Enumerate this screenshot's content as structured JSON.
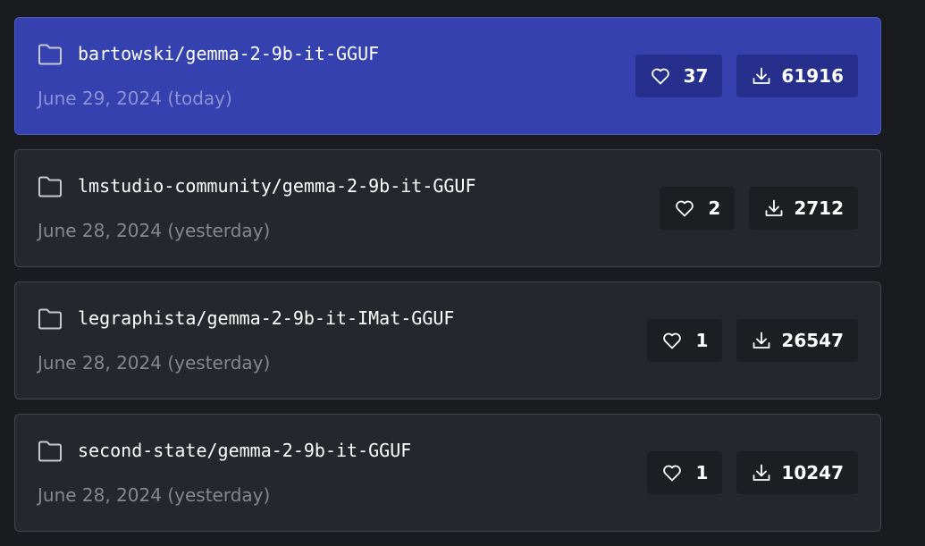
{
  "models": [
    {
      "name": "bartowski/gemma-2-9b-it-GGUF",
      "date": "June 29, 2024 (today)",
      "likes": "37",
      "downloads": "61916",
      "selected": true
    },
    {
      "name": "lmstudio-community/gemma-2-9b-it-GGUF",
      "date": "June 28, 2024 (yesterday)",
      "likes": "2",
      "downloads": "2712",
      "selected": false
    },
    {
      "name": "legraphista/gemma-2-9b-it-IMat-GGUF",
      "date": "June 28, 2024 (yesterday)",
      "likes": "1",
      "downloads": "26547",
      "selected": false
    },
    {
      "name": "second-state/gemma-2-9b-it-GGUF",
      "date": "June 28, 2024 (yesterday)",
      "likes": "1",
      "downloads": "10247",
      "selected": false
    }
  ],
  "colors": {
    "background": "#1a1b1f",
    "card": "#25272c",
    "card_selected": "#3441ae",
    "pill": "#1c1e22",
    "pill_selected": "#26308c",
    "muted_text": "#85888f"
  },
  "icons": {
    "folder": "folder-icon",
    "likes": "heart-icon",
    "downloads": "download-icon"
  }
}
